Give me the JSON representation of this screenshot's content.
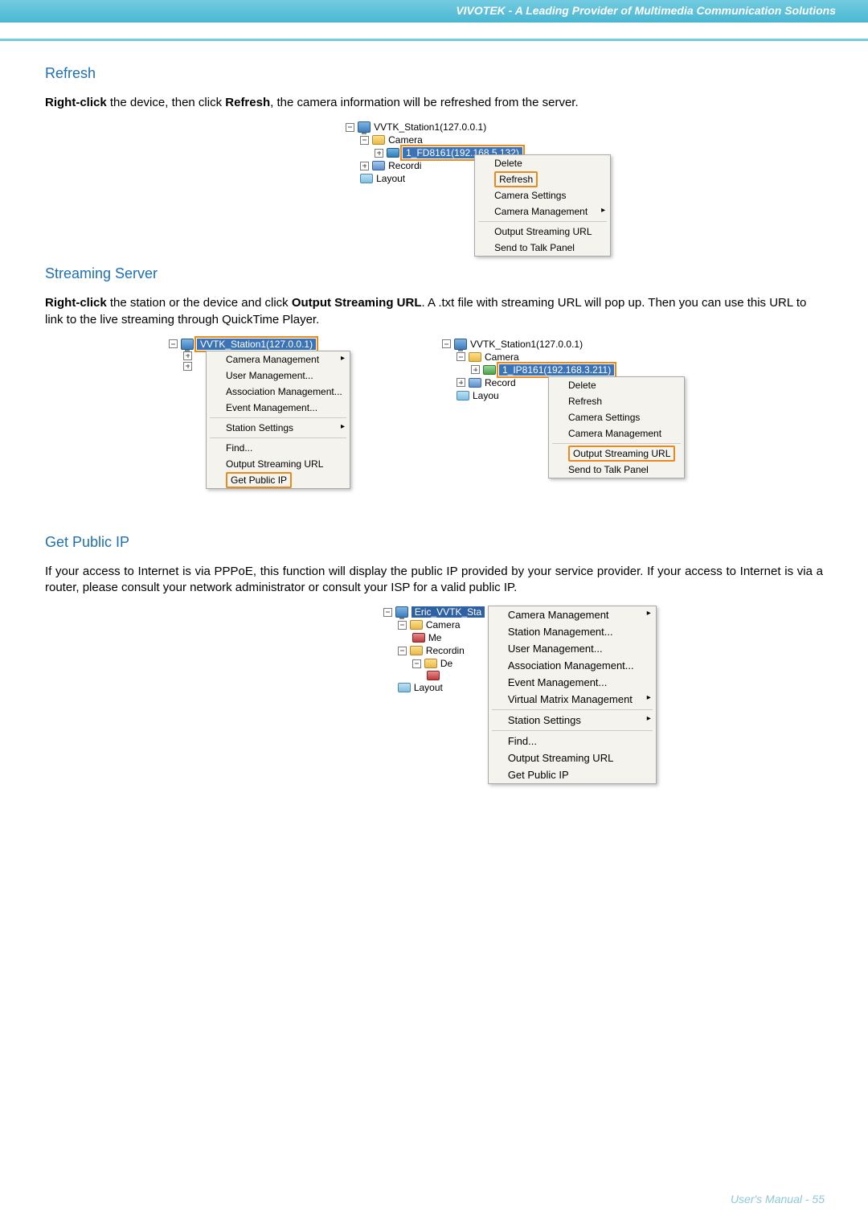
{
  "header": {
    "banner": "VIVOTEK - A Leading Provider of Multimedia Communication Solutions"
  },
  "sections": {
    "refresh": {
      "heading": "Refresh",
      "p1_a": "Right-click",
      "p1_b": " the device, then click ",
      "p1_c": "Refresh",
      "p1_d": ", the camera information will be refreshed from the server."
    },
    "streaming": {
      "heading": "Streaming Server",
      "p1_a": "Right-click",
      "p1_b": " the station or the device and click ",
      "p1_c": "Output Streaming URL",
      "p1_d": ". A .txt file with streaming URL will pop up. Then you can use this URL to link to the live streaming through QuickTime Player."
    },
    "publicip": {
      "heading": "Get Public IP",
      "p1": "If your access to Internet is via PPPoE, this function will display the public IP provided by your service provider. If your access to Internet is via a router, please consult your network administrator or consult your ISP for a valid public IP."
    }
  },
  "fig1": {
    "tree": {
      "station": "VVTK_Station1(127.0.0.1)",
      "camera": "Camera",
      "device": "1_FD8161(192.168.5.132)",
      "record": "Recordi",
      "layout": "Layout"
    },
    "menu": {
      "delete": "Delete",
      "refresh": "Refresh",
      "camera_settings": "Camera Settings",
      "camera_mgmt": "Camera Management",
      "output_url": "Output Streaming URL",
      "send_talk": "Send to Talk Panel"
    }
  },
  "fig2a": {
    "station": "VVTK_Station1(127.0.0.1)",
    "menu": {
      "camera_mgmt": "Camera Management",
      "user_mgmt": "User Management...",
      "assoc_mgmt": "Association Management...",
      "event_mgmt": "Event Management...",
      "station_settings": "Station Settings",
      "find": "Find...",
      "output_url": "Output Streaming URL",
      "get_ip": "Get Public IP"
    }
  },
  "fig2b": {
    "tree": {
      "station": "VVTK_Station1(127.0.0.1)",
      "camera": "Camera",
      "device": "1_IP8161(192.168.3.211)",
      "record": "Record",
      "layout": "Layou"
    },
    "menu": {
      "delete": "Delete",
      "refresh": "Refresh",
      "camera_settings": "Camera Settings",
      "camera_mgmt": "Camera Management",
      "output_url": "Output Streaming URL",
      "send_talk": "Send to Talk Panel"
    }
  },
  "fig3": {
    "tree": {
      "station": "Eric_VVTK_Sta",
      "camera": "Camera",
      "me": "Me",
      "recording": "Recordin",
      "de": "De",
      "layout": "Layout"
    },
    "menu": {
      "camera_mgmt": "Camera Management",
      "station_mgmt": "Station Management...",
      "user_mgmt": "User Management...",
      "assoc_mgmt": "Association Management...",
      "event_mgmt": "Event Management...",
      "virtual_matrix": "Virtual Matrix Management",
      "station_settings": "Station Settings",
      "find": "Find...",
      "output_url": "Output Streaming URL",
      "get_ip": "Get Public IP"
    }
  },
  "footer": {
    "text": "User's Manual - 55"
  }
}
